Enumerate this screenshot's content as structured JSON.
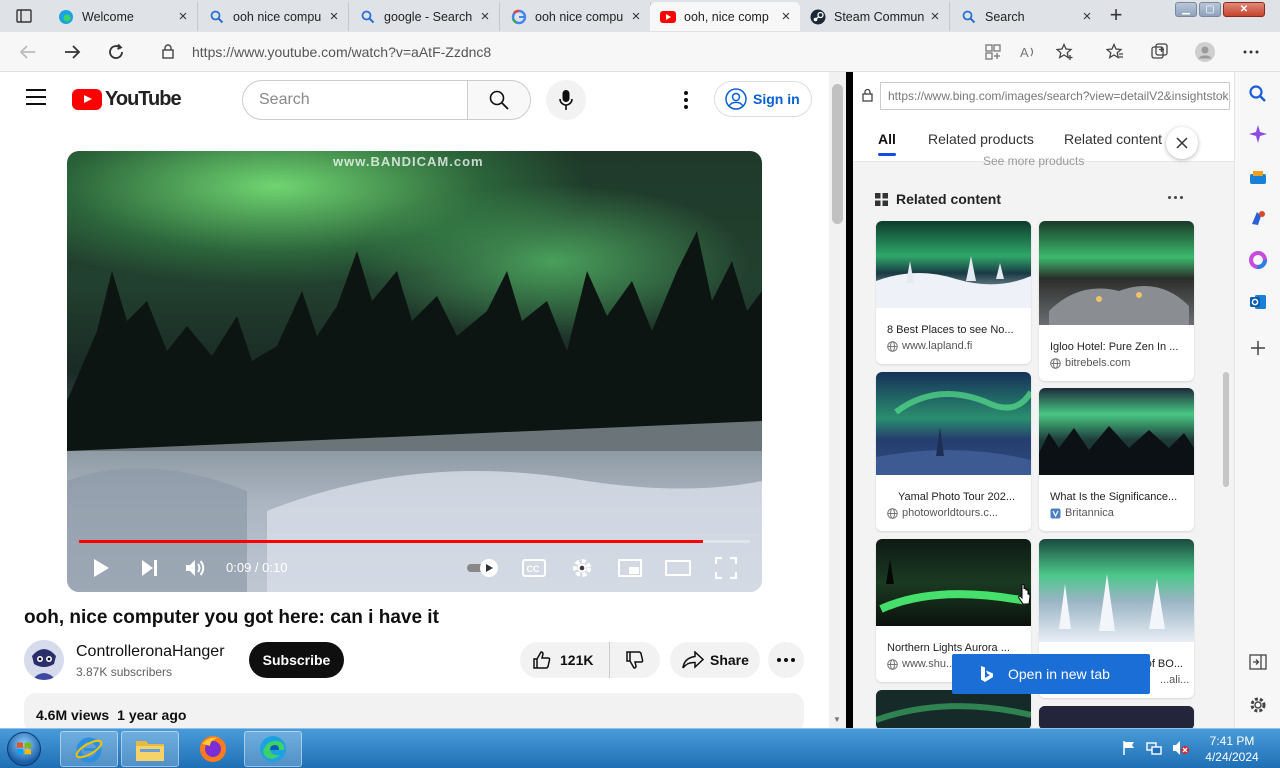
{
  "tabs": [
    {
      "title": "Welcome",
      "icon": "edge-icon"
    },
    {
      "title": "ooh nice compu",
      "icon": "search-icon"
    },
    {
      "title": "google - Search",
      "icon": "search-icon"
    },
    {
      "title": "ooh nice compu",
      "icon": "google-icon"
    },
    {
      "title": "ooh, nice comp",
      "icon": "youtube-icon",
      "active": true
    },
    {
      "title": "Steam Commun",
      "icon": "steam-icon"
    },
    {
      "title": "Search",
      "icon": "search-icon"
    }
  ],
  "address": {
    "url": "https://www.youtube.com/watch?v=aAtF-Zzdnc8"
  },
  "youtube": {
    "logo_text": "YouTube",
    "search_placeholder": "Search",
    "signin_label": "Sign in",
    "video": {
      "watermark": "www.BANDICAM.com",
      "time": "0:09 / 0:10",
      "progress": 0.93
    },
    "title": "ooh, nice computer you got here: can i have it",
    "channel": {
      "name": "ControlleronaHanger",
      "subscribers": "3.87K subscribers"
    },
    "subscribe_label": "Subscribe",
    "likes": "121K",
    "share_label": "Share",
    "views": "4.6M views",
    "age": "1 year ago"
  },
  "sidebar": {
    "url": "https://www.bing.com/images/search?view=detailV2&insightstoken",
    "tabs": [
      "All",
      "Related products",
      "Related content"
    ],
    "see_more": "See more products",
    "section_title": "Related content",
    "cards": [
      {
        "title": "8 Best Places to see No...",
        "source": "www.lapland.fi"
      },
      {
        "title": "Igloo Hotel: Pure Zen In ...",
        "source": "bitrebels.com"
      },
      {
        "title": " Yamal Photo Tour 202...",
        "source": "photoworldtours.c..."
      },
      {
        "title": "What Is the Significance...",
        "source": "Britannica"
      },
      {
        "title": "Northern Lights Aurora ...",
        "source": "www.shu..."
      },
      {
        "title": "...of BO...",
        "source": "...ali..."
      }
    ],
    "open_new_tab_label": "Open in new tab"
  },
  "taskbar": {
    "time": "7:41 PM",
    "date": "4/24/2024"
  },
  "colors": {
    "youtube_red": "#ff0000",
    "signin_blue": "#065fd4",
    "bing_blue": "#1b6ed6",
    "taskbar_blue": "#1f6fb6"
  }
}
